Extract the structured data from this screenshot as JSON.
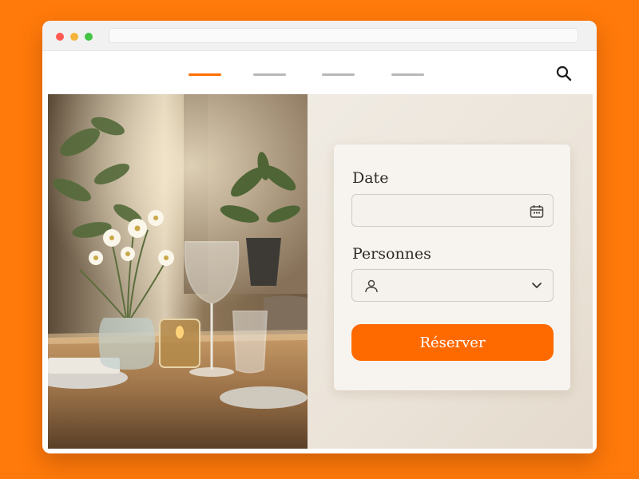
{
  "browser": {
    "url": ""
  },
  "navigation": {
    "items": [
      {
        "label": "",
        "active": true
      },
      {
        "label": "",
        "active": false
      },
      {
        "label": "",
        "active": false
      },
      {
        "label": "",
        "active": false
      }
    ],
    "search_icon": "search-icon"
  },
  "booking_form": {
    "date_label": "Date",
    "date_value": "",
    "date_icon": "calendar-icon",
    "persons_label": "Personnes",
    "persons_value": "",
    "persons_icon": "person-icon",
    "persons_dropdown_icon": "chevron-down-icon",
    "submit_label": "Réserver"
  },
  "colors": {
    "background": "#ff7a0a",
    "accent": "#ff6a00",
    "nav_active": "#ff6f00",
    "nav_inactive": "#b8b8b8"
  }
}
